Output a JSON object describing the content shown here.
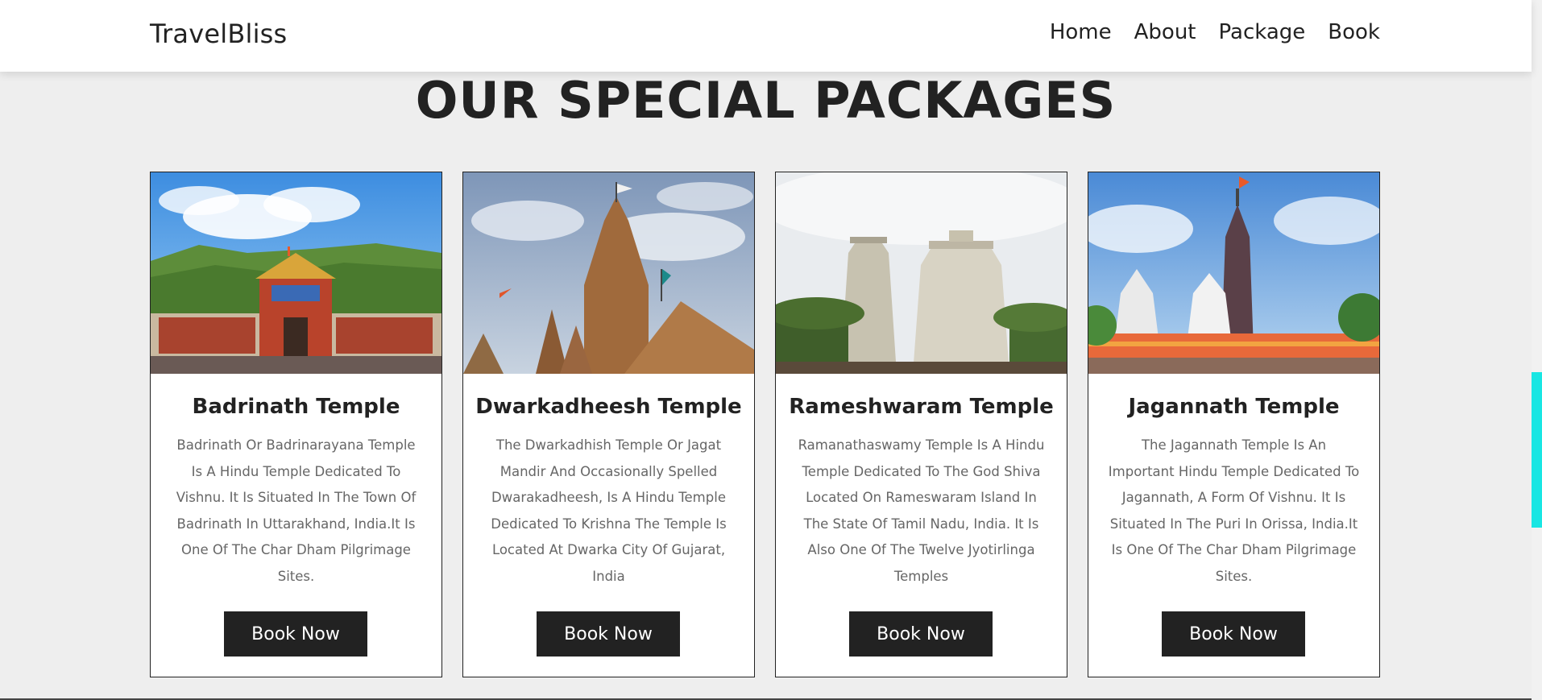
{
  "header": {
    "logo": "TravelBliss",
    "nav": [
      "Home",
      "About",
      "Package",
      "Book"
    ]
  },
  "section": {
    "title": "OUR SPECIAL PACKAGES"
  },
  "packages": [
    {
      "title": "Badrinath Temple",
      "description": "Badrinath Or Badrinarayana Temple Is A Hindu Temple Dedicated To Vishnu. It Is Situated In The Town Of Badrinath In Uttarakhand, India.It Is One Of The Char Dham Pilgrimage Sites.",
      "button": "Book Now"
    },
    {
      "title": "Dwarkadheesh Temple",
      "description": "The Dwarkadhish Temple Or Jagat Mandir And Occasionally Spelled Dwarakadheesh, Is A Hindu Temple Dedicated To Krishna The Temple Is Located At Dwarka City Of Gujarat, India",
      "button": "Book Now"
    },
    {
      "title": "Rameshwaram Temple",
      "description": "Ramanathaswamy Temple Is A Hindu Temple Dedicated To The God Shiva Located On Rameswaram Island In The State Of Tamil Nadu, India. It Is Also One Of The Twelve Jyotirlinga Temples",
      "button": "Book Now"
    },
    {
      "title": "Jagannath Temple",
      "description": "The Jagannath Temple Is An Important Hindu Temple Dedicated To Jagannath, A Form Of Vishnu. It Is Situated In The Puri In Orissa, India.It Is One Of The Char Dham Pilgrimage Sites.",
      "button": "Book Now"
    }
  ],
  "colors": {
    "background": "#eeeeee",
    "button": "#222222",
    "scroll_thumb": "#19e6e3"
  }
}
